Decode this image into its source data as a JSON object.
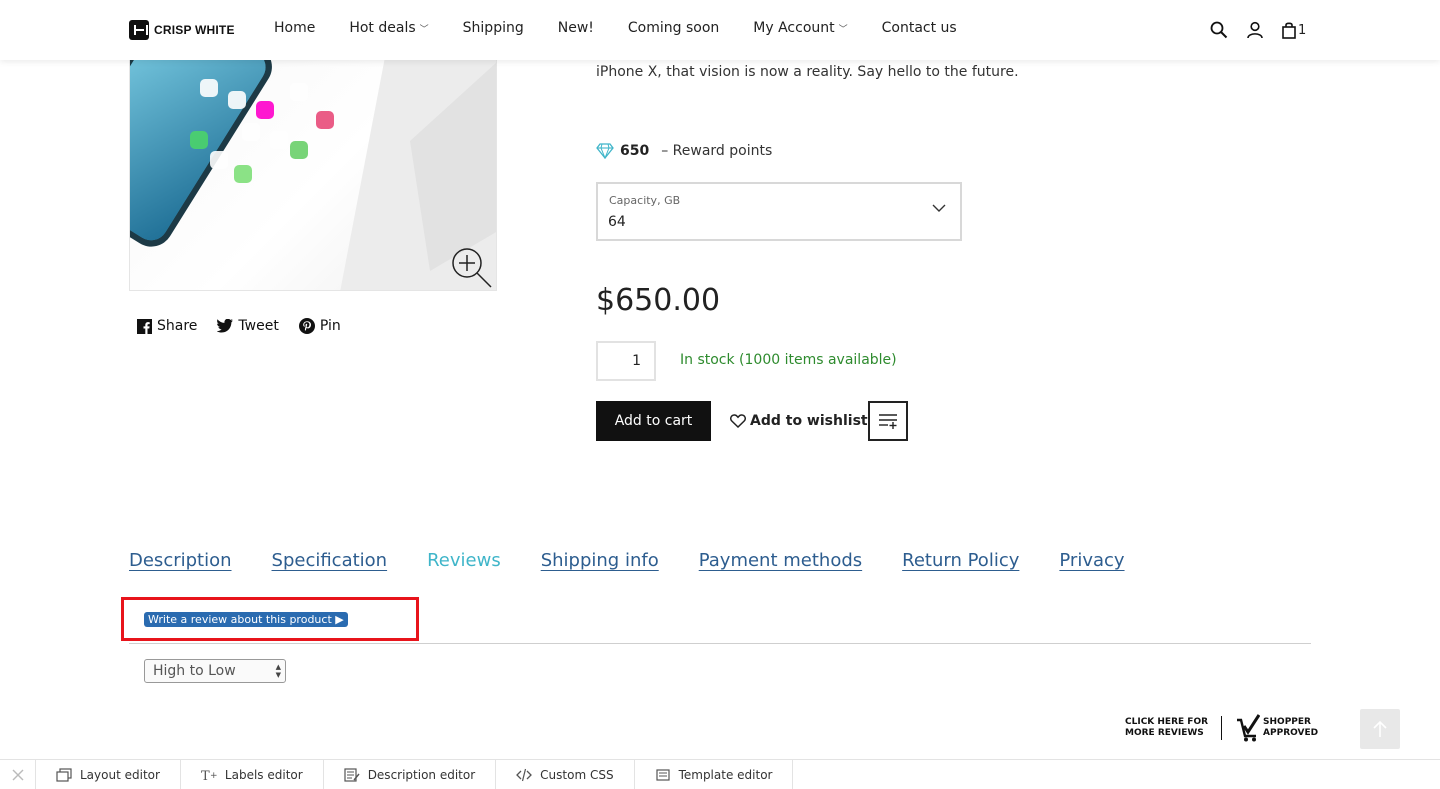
{
  "header": {
    "logo_text": "CRISP WHITE",
    "nav": [
      {
        "label": "Home",
        "has_dropdown": false
      },
      {
        "label": "Hot deals",
        "has_dropdown": true
      },
      {
        "label": "Shipping",
        "has_dropdown": false
      },
      {
        "label": "New!",
        "has_dropdown": false
      },
      {
        "label": "Coming soon",
        "has_dropdown": false
      },
      {
        "label": "My Account",
        "has_dropdown": true
      },
      {
        "label": "Contact us",
        "has_dropdown": false
      }
    ],
    "cart_count": "1",
    "icons": [
      "search-icon",
      "user-icon",
      "shopping-bag-icon"
    ]
  },
  "product": {
    "description_tail": "iPhone X, that vision is now a reality. Say hello to the future.",
    "reward_points": "650",
    "reward_label": "– Reward points",
    "capacity_label": "Capacity, GB",
    "capacity_value": "64",
    "price": "$650.00",
    "quantity": "1",
    "stock_text": "In stock (1000 items available)",
    "add_to_cart": "Add to cart",
    "add_to_wishlist": "Add to wishlist"
  },
  "share": {
    "facebook": "Share",
    "twitter": "Tweet",
    "pinterest": "Pin"
  },
  "tabs": [
    {
      "label": "Description",
      "active": false
    },
    {
      "label": "Specification",
      "active": false
    },
    {
      "label": "Reviews",
      "active": true
    },
    {
      "label": "Shipping info",
      "active": false
    },
    {
      "label": "Payment methods",
      "active": false
    },
    {
      "label": "Return Policy",
      "active": false
    },
    {
      "label": "Privacy",
      "active": false
    }
  ],
  "reviews": {
    "write_review": "Write a review about this product ▶",
    "sort_value": "High to Low",
    "shopper_left_line1": "CLICK HERE FOR",
    "shopper_left_line2": "MORE REVIEWS",
    "shopper_right_line1": "SHOPPER",
    "shopper_right_line2": "APPROVED"
  },
  "editor_bar": {
    "items": [
      {
        "label": "Layout editor",
        "icon": "layout-icon"
      },
      {
        "label": "Labels editor",
        "icon": "text-icon"
      },
      {
        "label": "Description editor",
        "icon": "description-icon"
      },
      {
        "label": "Custom CSS",
        "icon": "code-icon"
      },
      {
        "label": "Template editor",
        "icon": "template-icon"
      }
    ]
  },
  "colors": {
    "accent_tab": "#3fb5c9",
    "link_tab": "#2d5d8f",
    "stock_green": "#2e8b2e",
    "highlight_red": "#e8141b",
    "review_button": "#2a6bb0"
  }
}
